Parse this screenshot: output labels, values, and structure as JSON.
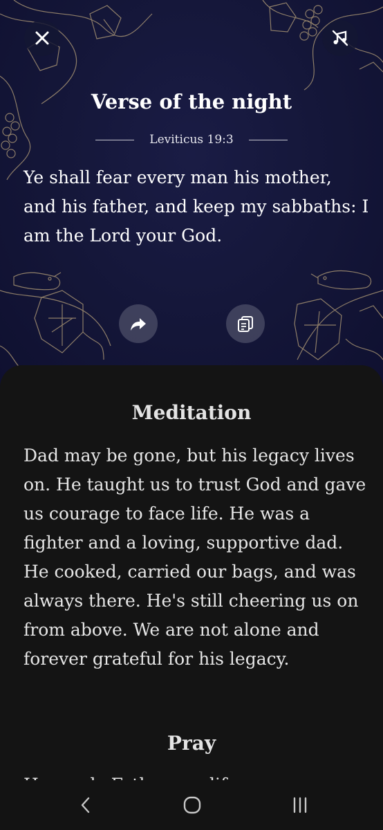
{
  "header": {
    "close_icon": "close-icon",
    "music_icon": "music-off-icon"
  },
  "verse": {
    "title": "Verse of the night",
    "reference": "Leviticus 19:3",
    "text": "Ye shall fear every man his mother, and his father, and keep my sabbaths: I am the Lord your God."
  },
  "actions": {
    "share_icon": "share-icon",
    "copy_icon": "copy-icon"
  },
  "meditation": {
    "title": "Meditation",
    "text": "Dad may be gone, but his legacy lives on. He taught us to trust God and gave us courage to face life. He was a fighter and a loving, supportive dad. He cooked, carried our bags, and was always there. He's still cheering us on from above. We are not alone and forever grateful for his legacy."
  },
  "pray": {
    "title": "Pray",
    "text_partial": "Heavenly Father, my life..."
  },
  "navbar": {
    "back_icon": "back-icon",
    "home_icon": "home-icon",
    "recents_icon": "recents-icon"
  },
  "colors": {
    "hero_bg": "#141638",
    "sheet_bg": "#141414",
    "ornament_gold": "#b8a27a"
  }
}
